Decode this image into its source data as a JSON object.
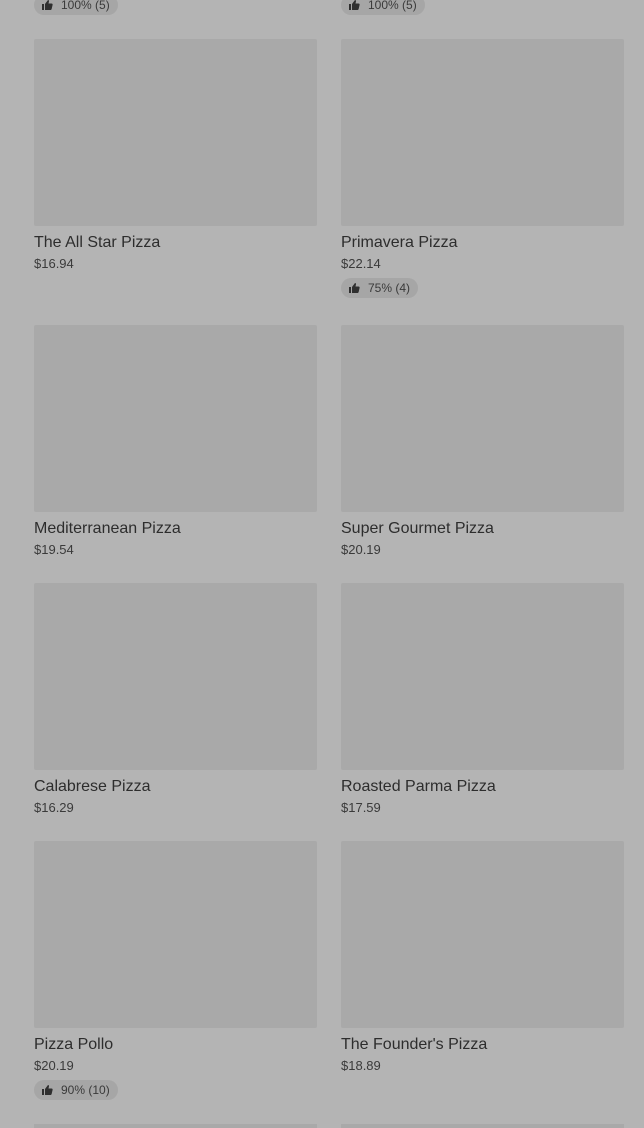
{
  "top_ratings": [
    {
      "text": "100% (5)"
    },
    {
      "text": "100% (5)"
    }
  ],
  "products": [
    {
      "name": "The All Star Pizza",
      "price": "$16.94"
    },
    {
      "name": "Primavera Pizza",
      "price": "$22.14",
      "rating": "75% (4)"
    },
    {
      "name": "Mediterranean Pizza",
      "price": "$19.54"
    },
    {
      "name": "Super Gourmet Pizza",
      "price": "$20.19"
    },
    {
      "name": "Calabrese Pizza",
      "price": "$16.29"
    },
    {
      "name": "Roasted Parma Pizza",
      "price": "$17.59"
    },
    {
      "name": "Pizza Pollo",
      "price": "$20.19",
      "rating": "90% (10)"
    },
    {
      "name": "The Founder's Pizza",
      "price": "$18.89"
    }
  ],
  "icons": {
    "rating": "thumbs-up-icon"
  },
  "colors": {
    "overlay_background": "#b4b4b4",
    "image_placeholder": "#a9a9a9"
  }
}
